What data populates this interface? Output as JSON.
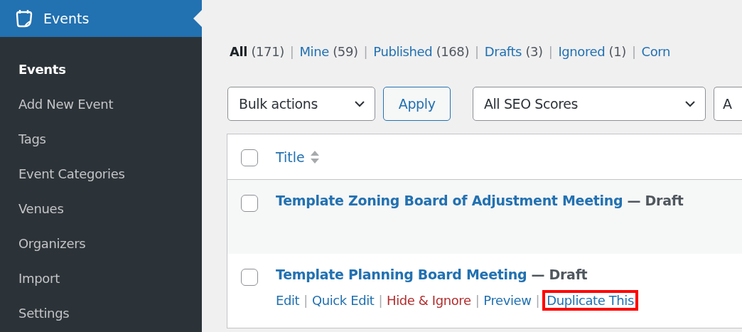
{
  "sidebar": {
    "header": {
      "title": "Events",
      "selected": true
    },
    "items": [
      {
        "label": "Events",
        "selected": true
      },
      {
        "label": "Add New Event",
        "selected": false
      },
      {
        "label": "Tags",
        "selected": false
      },
      {
        "label": "Event Categories",
        "selected": false
      },
      {
        "label": "Venues",
        "selected": false
      },
      {
        "label": "Organizers",
        "selected": false
      },
      {
        "label": "Import",
        "selected": false
      },
      {
        "label": "Settings",
        "selected": false
      }
    ]
  },
  "status_links": [
    {
      "label": "All",
      "count": "(171)",
      "selected": true
    },
    {
      "separator": "|",
      "label": "Mine",
      "count": "(59)",
      "selected": false
    },
    {
      "separator": "|",
      "label": "Published",
      "count": "(168)",
      "selected": false
    },
    {
      "separator": "|",
      "label": "Drafts",
      "count": "(3)",
      "selected": false
    },
    {
      "separator": "|",
      "label": "Ignored",
      "count": "(1)",
      "selected": false
    },
    {
      "separator": "|",
      "label": "Corn",
      "selected": false
    }
  ],
  "toolbar": {
    "bulk_actions": "Bulk actions",
    "apply": "Apply",
    "seo_filter": "All SEO Scores",
    "filter_3": "A"
  },
  "table": {
    "select_all_checked": false,
    "columns": [
      {
        "label": "Title",
        "sortable": true
      }
    ],
    "rows": [
      {
        "title": "Template Zoning Board of Adjustment Meeting",
        "state": "— Draft",
        "checked": false,
        "actions": []
      },
      {
        "title": "Template Planning Board Meeting",
        "state": "— Draft",
        "checked": false,
        "actions": [
          {
            "label": "Edit",
            "kind": "normal",
            "highlighted": false
          },
          {
            "separator": "|",
            "label": "Quick Edit",
            "kind": "normal",
            "highlighted": false
          },
          {
            "separator": "|",
            "label": "Hide & Ignore",
            "kind": "danger",
            "highlighted": false
          },
          {
            "separator": "|",
            "label": "Preview",
            "kind": "normal",
            "highlighted": false
          },
          {
            "separator": "|",
            "label": "Duplicate This",
            "kind": "normal",
            "highlighted": true
          }
        ]
      }
    ]
  }
}
